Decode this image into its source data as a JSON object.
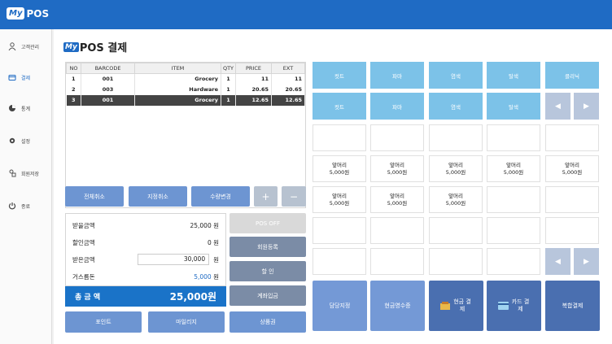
{
  "brand": {
    "my": "My",
    "pos": "POS"
  },
  "sidebar": {
    "items": [
      {
        "label": "고객관리",
        "icon": "user-icon"
      },
      {
        "label": "결제",
        "icon": "wallet-icon"
      },
      {
        "label": "통계",
        "icon": "pie-chart-icon"
      },
      {
        "label": "설정",
        "icon": "gear-icon"
      },
      {
        "label": "회원저장",
        "icon": "member-icon"
      },
      {
        "label": "종료",
        "icon": "power-icon"
      }
    ]
  },
  "title": {
    "my": "My",
    "pos": "POS 결제"
  },
  "table": {
    "headers": [
      "NO",
      "BARCODE",
      "ITEM",
      "QTY",
      "PRICE",
      "EXT"
    ],
    "rows": [
      [
        "1",
        "001",
        "Grocery",
        "1",
        "11",
        "11"
      ],
      [
        "2",
        "003",
        "Hardware",
        "1",
        "20.65",
        "20.65"
      ],
      [
        "3",
        "001",
        "Grocery",
        "1",
        "12.65",
        "12.65"
      ]
    ]
  },
  "actions": {
    "cancel_all": "전체취소",
    "cancel_selected": "지정취소",
    "change_qty": "수량변경",
    "plus": "+",
    "minus": "−"
  },
  "summary": {
    "receivable_label": "받을금액",
    "receivable": "25,000 원",
    "discount_label": "할인금액",
    "discount": "0 원",
    "received_label": "받은금액",
    "received": "30,000",
    "received_unit": "원",
    "change_label": "거스름돈",
    "change": "5,000",
    "change_unit": "원",
    "total_label": "총 금 액",
    "total": "25,000원"
  },
  "side_buttons": {
    "pos_off": "POS OFF",
    "member_register": "회원등록",
    "discount": "할 인",
    "account_deposit": "계좌입금"
  },
  "bottom_buttons": {
    "point": "포인트",
    "mileage": "마일리지",
    "gift": "상품권"
  },
  "categories": {
    "row1": [
      "컷트",
      "파마",
      "염색",
      "탈색",
      "클리닉"
    ],
    "row2": [
      "컷트",
      "파마",
      "염색",
      "탈색"
    ]
  },
  "products": {
    "name": "앞머리",
    "price": "5,000원"
  },
  "pay": {
    "staff": "담당지정",
    "cash_receipt": "현금영수증",
    "cash": "현금 결제",
    "card": "카드 결제",
    "complex": "복합결제"
  },
  "colors": {
    "header": "#1f6bc4",
    "total": "#1a73c8",
    "category": "#7cc2e8"
  }
}
